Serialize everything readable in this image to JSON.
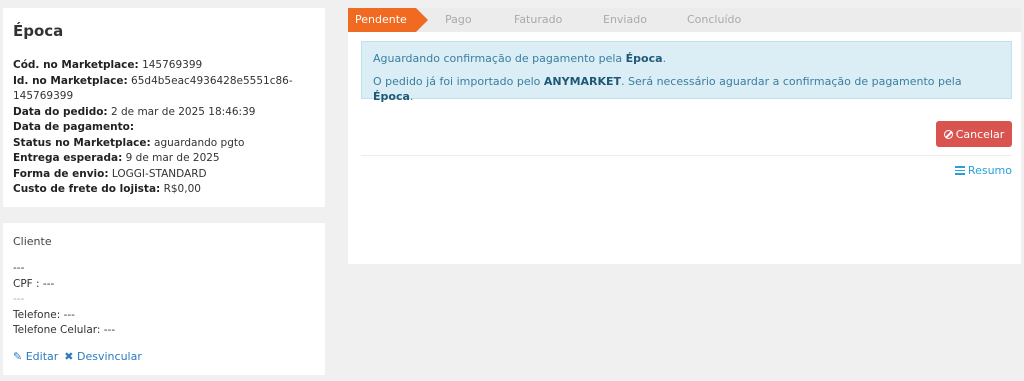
{
  "order": {
    "title": "Época",
    "fields": [
      {
        "label": "Cód. no Marketplace:",
        "value": " 145769399"
      },
      {
        "label": "Id. no Marketplace:",
        "value": " 65d4b5eac4936428e5551c86-"
      },
      {
        "label": "",
        "value": "145769399"
      },
      {
        "label": "Data do pedido:",
        "value": " 2 de mar de 2025 18:46:39"
      },
      {
        "label": "Data de pagamento:",
        "value": ""
      },
      {
        "label": "Status no Marketplace:",
        "value": " aguardando pgto"
      },
      {
        "label": "Entrega esperada:",
        "value": " 9 de mar de 2025"
      },
      {
        "label": "Forma de envio:",
        "value": " LOGGI-STANDARD"
      },
      {
        "label": "Custo de frete do lojista:",
        "value": " R$0,00"
      }
    ]
  },
  "client": {
    "heading": "Cliente",
    "name": "---",
    "cpf": "CPF : ---",
    "email": "---",
    "phone": "Telefone: ---",
    "mobile": "Telefone Celular: ---",
    "edit_label": "Editar",
    "unlink_label": "Desvincular"
  },
  "steps": {
    "active": "Pendente",
    "items": [
      "Pago",
      "Faturado",
      "Enviado",
      "Concluído"
    ]
  },
  "alert": {
    "line1_prefix": "Aguardando confirmação de pagamento pela ",
    "line1_strong": "Época",
    "line1_suffix": ".",
    "line2_prefix": "O pedido já foi importado pelo ",
    "line2_strong1": "ANYMARKET",
    "line2_mid": ". Será necessário aguardar a confirmação de pagamento pela ",
    "line2_strong2": "Época",
    "line2_suffix": "."
  },
  "buttons": {
    "cancel_label": "Cancelar",
    "resumo_label": "Resumo"
  },
  "colors": {
    "active_step": "#f06a22",
    "cancel": "#d9534f",
    "link": "#2a7bbf",
    "alert_bg": "#dbeef6"
  }
}
